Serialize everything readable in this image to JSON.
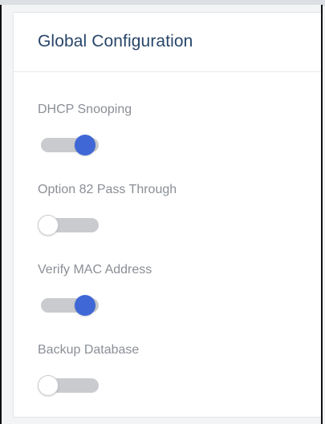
{
  "panel": {
    "title": "Global Configuration"
  },
  "settings": [
    {
      "label": "DHCP Snooping",
      "enabled": true
    },
    {
      "label": "Option 82 Pass Through",
      "enabled": false
    },
    {
      "label": "Verify MAC Address",
      "enabled": true
    },
    {
      "label": "Backup Database",
      "enabled": false
    }
  ],
  "colors": {
    "title": "#28466a",
    "label": "#8a8f96",
    "toggle_on": "#3f67d6",
    "toggle_track": "#c9cbcf"
  }
}
